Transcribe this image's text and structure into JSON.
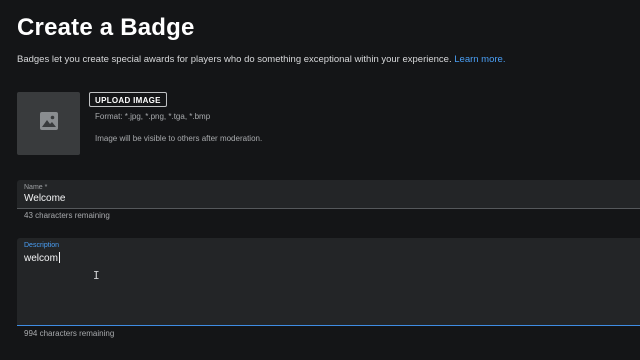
{
  "page": {
    "title": "Create a Badge",
    "intro_text": "Badges let you create special awards for players who do something exceptional within your experience.",
    "learn_more_link": "Learn more."
  },
  "image_upload": {
    "thumbnail_icon": "image-placeholder-icon",
    "button_label": "UPLOAD IMAGE",
    "format_text": "Format: *.jpg, *.png, *.tga, *.bmp",
    "moderation_text": "Image will be visible to others after moderation."
  },
  "name_field": {
    "label": "Name *",
    "value": "Welcome",
    "counter": "43 characters remaining"
  },
  "description_field": {
    "label": "Description",
    "value": "welcom",
    "counter": "994 characters remaining",
    "focused": true
  },
  "colors": {
    "background": "#141517",
    "field_background": "#232527",
    "link": "#4a9ff5",
    "focus_border": "#3f8de3"
  }
}
